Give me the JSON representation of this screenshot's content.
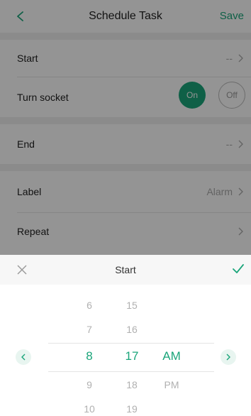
{
  "header": {
    "title": "Schedule Task",
    "save_label": "Save"
  },
  "rows": {
    "start": {
      "label": "Start",
      "value": "--"
    },
    "turn_socket": {
      "label": "Turn socket",
      "on_label": "On",
      "off_label": "Off"
    },
    "end": {
      "label": "End",
      "value": "--"
    },
    "label": {
      "label": "Label",
      "value": "Alarm"
    },
    "repeat": {
      "label": "Repeat",
      "value": ""
    }
  },
  "sheet": {
    "title": "Start",
    "hours": [
      "6",
      "7",
      "8",
      "9",
      "10"
    ],
    "minutes": [
      "15",
      "16",
      "17",
      "18",
      "19"
    ],
    "meridiem": [
      "",
      "",
      "AM",
      "PM",
      ""
    ],
    "selected_index": 2
  },
  "colors": {
    "accent": "#1aa57a",
    "overlay": "rgba(0,0,0,0.42)"
  },
  "icons": {
    "back": "chevron-left-icon",
    "chevron": "chevron-right-icon",
    "close": "close-icon",
    "confirm": "check-icon",
    "prev": "chevron-left-icon",
    "next": "chevron-right-icon"
  }
}
